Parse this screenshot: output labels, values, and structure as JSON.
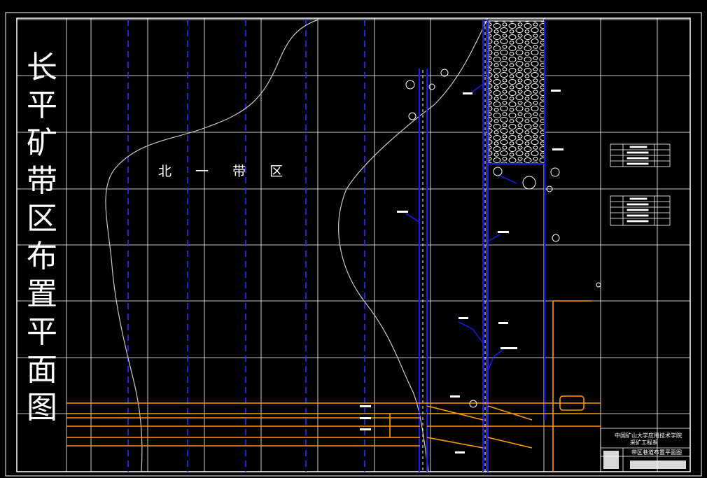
{
  "drawing": {
    "title_chars": [
      "长",
      "平",
      "矿",
      "带",
      "区",
      "布",
      "置",
      "平",
      "面",
      "图"
    ],
    "zone_label": "北 一 带 区",
    "colors": {
      "background": "#000000",
      "grid": "#ffffff",
      "roadway": "#ff9900",
      "dashed_line": "#2233ff",
      "main_roadway": "#1a1aff",
      "contour": "#c8c8c8",
      "goaf_fill": "#ffffff"
    }
  },
  "title_block": {
    "school": "中国矿山大学应用技术学院",
    "department": "采矿工程系",
    "drawing_name": "带区巷道布置平面图"
  }
}
